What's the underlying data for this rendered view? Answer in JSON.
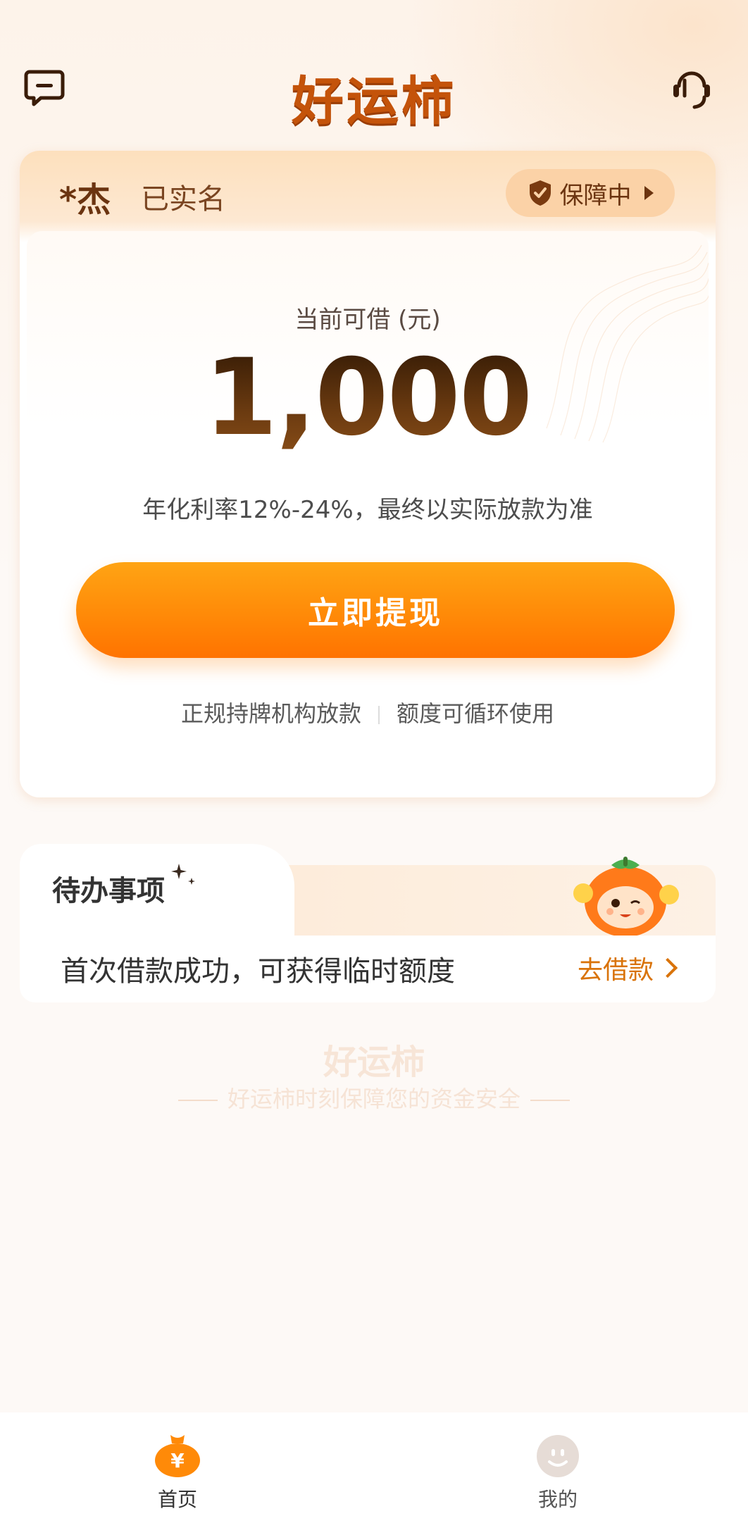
{
  "header": {
    "title": "好运柿"
  },
  "card": {
    "user_name": "*杰",
    "verify_status": "已实名",
    "guard_label": "保障中",
    "amount_label": "当前可借 (元)",
    "amount": "1,000",
    "rate_note": "年化利率12%-24%，最终以实际放款为准",
    "withdraw_label": "立即提现",
    "feature_1": "正规持牌机构放款",
    "feature_2": "额度可循环使用"
  },
  "todo": {
    "title": "待办事项",
    "text": "首次借款成功，可获得临时额度",
    "action_label": "去借款"
  },
  "watermark": {
    "title": "好运柿",
    "subtitle": "好运柿时刻保障您的资金安全"
  },
  "nav": {
    "home_label": "首页",
    "mine_label": "我的"
  },
  "colors": {
    "accent": "#ff8a08",
    "title": "#c4530a",
    "action": "#d9730a"
  }
}
